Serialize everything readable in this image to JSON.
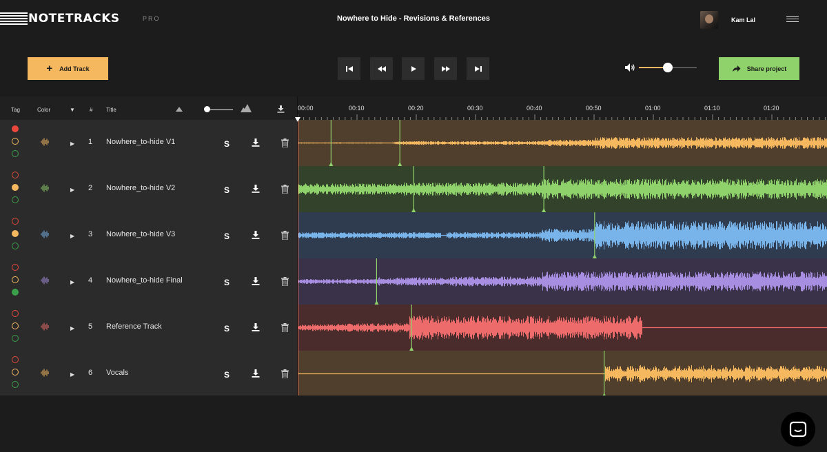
{
  "app": {
    "name": "NOTETRACKS",
    "tier": "PRO"
  },
  "project": {
    "title": "Nowhere to Hide - Revisions & References"
  },
  "user": {
    "name": "Kam Lal"
  },
  "toolbar": {
    "add_track_label": "Add Track",
    "share_label": "Share project",
    "volume": 0.5
  },
  "table": {
    "headers": {
      "tag": "Tag",
      "color": "Color",
      "num": "#",
      "title": "Title"
    },
    "zoom": 0.08
  },
  "timeline": {
    "ticks": [
      "00:00",
      "00:10",
      "00:20",
      "00:30",
      "00:40",
      "00:50",
      "01:00",
      "01:10",
      "01:20"
    ],
    "playhead": "00:00"
  },
  "tracks": [
    {
      "num": "1",
      "title": "Nowhere_to-hide V1",
      "solo": "S",
      "tag": "red",
      "color": "#f5b85f",
      "lane": "#4f3f2c",
      "markers": [
        0.063,
        0.193
      ]
    },
    {
      "num": "2",
      "title": "Nowhere_to-hide V2",
      "solo": "S",
      "tag": "orange",
      "color": "#8fd16a",
      "lane": "#33432b",
      "markers": [
        0.219,
        0.465
      ]
    },
    {
      "num": "3",
      "title": "Nowhere_to-hide V3",
      "solo": "S",
      "tag": "orange",
      "color": "#78b4ea",
      "lane": "#2f3c4f",
      "markers": [
        0.561
      ]
    },
    {
      "num": "4",
      "title": "Nowhere_to-hide Final",
      "solo": "S",
      "tag": "green",
      "color": "#a78ee0",
      "lane": "#3a3249",
      "markers": [
        0.149
      ]
    },
    {
      "num": "5",
      "title": "Reference Track",
      "solo": "S",
      "tag": "none",
      "color": "#ee6b6b",
      "lane": "#4a2c2c",
      "markers": [
        0.215
      ]
    },
    {
      "num": "6",
      "title": "Vocals",
      "solo": "S",
      "tag": "none",
      "color": "#f5b85f",
      "lane": "#4f3f2c",
      "markers": [
        0.579
      ]
    }
  ],
  "tag_colors": {
    "red": "#e9483b",
    "orange": "#f5b85f",
    "green": "#3aa14a"
  },
  "icons": [
    "menu-icon",
    "skip-back-icon",
    "rewind-icon",
    "play-icon",
    "fast-forward-icon",
    "skip-forward-icon",
    "volume-icon",
    "share-arrow-icon",
    "download-icon",
    "trash-icon",
    "waveform-icon",
    "chat-icon"
  ]
}
